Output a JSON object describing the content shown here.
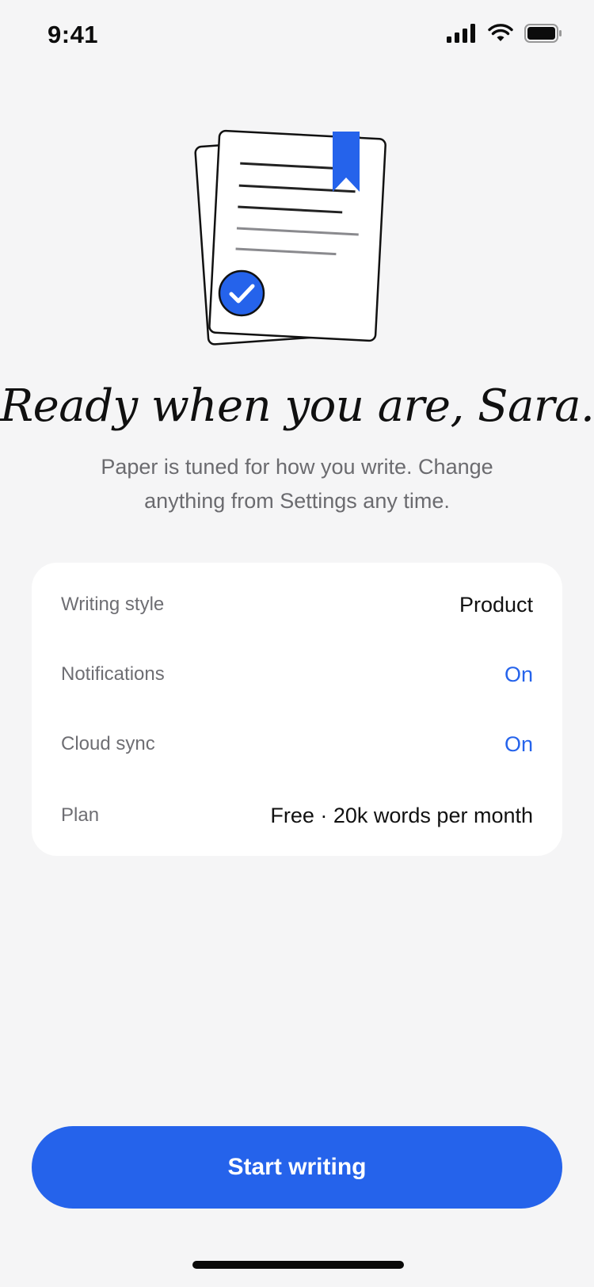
{
  "status_bar": {
    "time": "9:41",
    "icons": [
      "cellular-signal-icon",
      "wifi-icon",
      "battery-icon"
    ]
  },
  "illustration": {
    "icon": "document-stack-icon",
    "badge_icon": "checkmark-circle-icon",
    "bookmark_icon": "bookmark-icon"
  },
  "headline": "Ready when you are, Sara.",
  "subtitle": "Paper is tuned for how you write. Change anything from Settings any time.",
  "settings": [
    {
      "label": "Writing style",
      "value": "Product",
      "accent": false
    },
    {
      "label": "Notifications",
      "value": "On",
      "accent": true
    },
    {
      "label": "Cloud sync",
      "value": "On",
      "accent": true
    },
    {
      "label": "Plan",
      "value": "Free · 20k words per month",
      "accent": false
    }
  ],
  "cta": {
    "label": "Start writing"
  },
  "colors": {
    "accent": "#2563eb",
    "background": "#f5f5f6",
    "card": "#ffffff",
    "muted_text": "#6e6e73"
  }
}
